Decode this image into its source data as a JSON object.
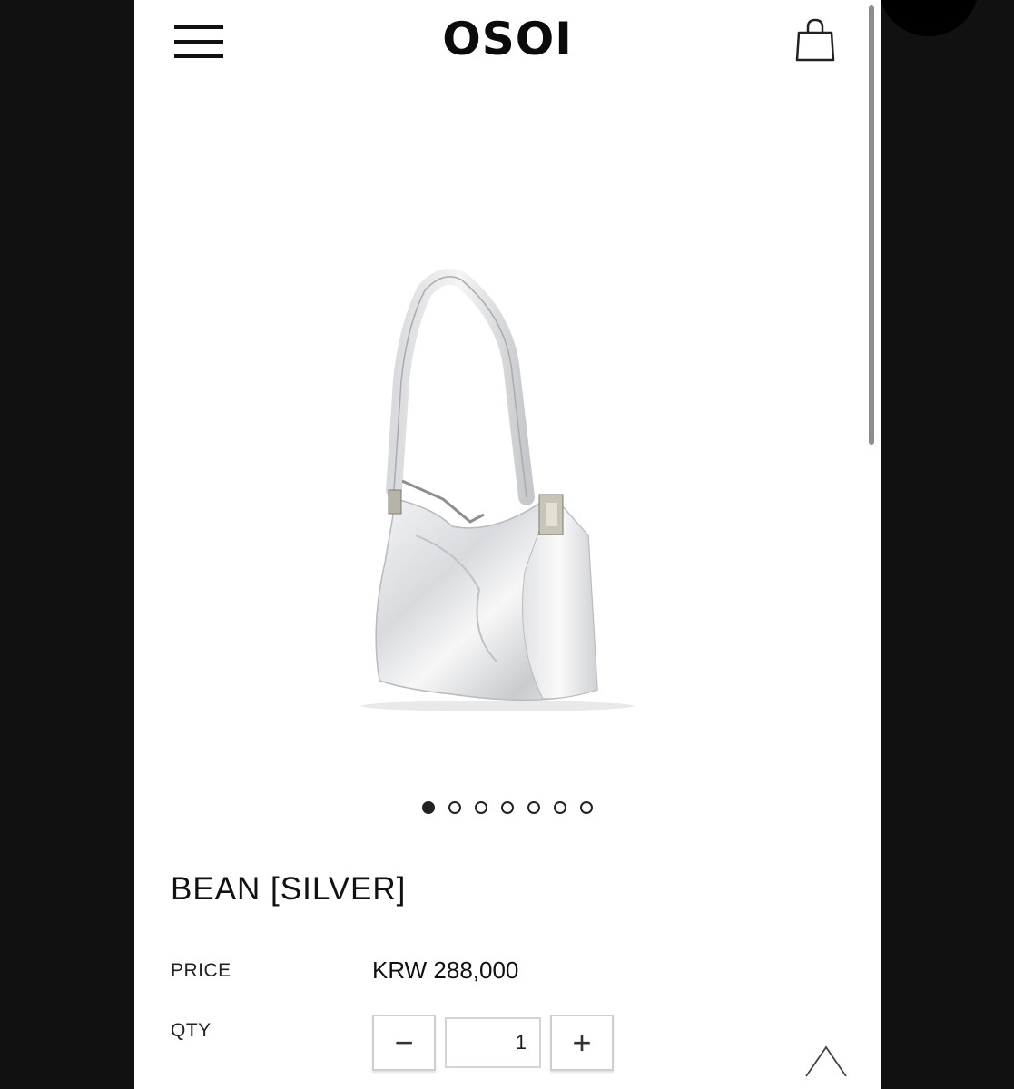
{
  "header": {
    "menu_icon": "hamburger-menu-icon",
    "logo_text": "OSOI",
    "cart_icon": "shopping-bag-icon"
  },
  "gallery": {
    "image_subject": "silver-shoulder-bag",
    "total_slides": 7,
    "active_slide": 1
  },
  "product": {
    "title": "BEAN [SILVER]",
    "price_label": "PRICE",
    "price_value": "KRW 288,000",
    "qty_label": "QTY",
    "qty_value": "1",
    "minus_symbol": "−",
    "plus_symbol": "+"
  },
  "scroll_top_icon": "chevron-up-icon",
  "colors": {
    "background": "#111111",
    "page": "#ffffff",
    "text": "#111111"
  }
}
